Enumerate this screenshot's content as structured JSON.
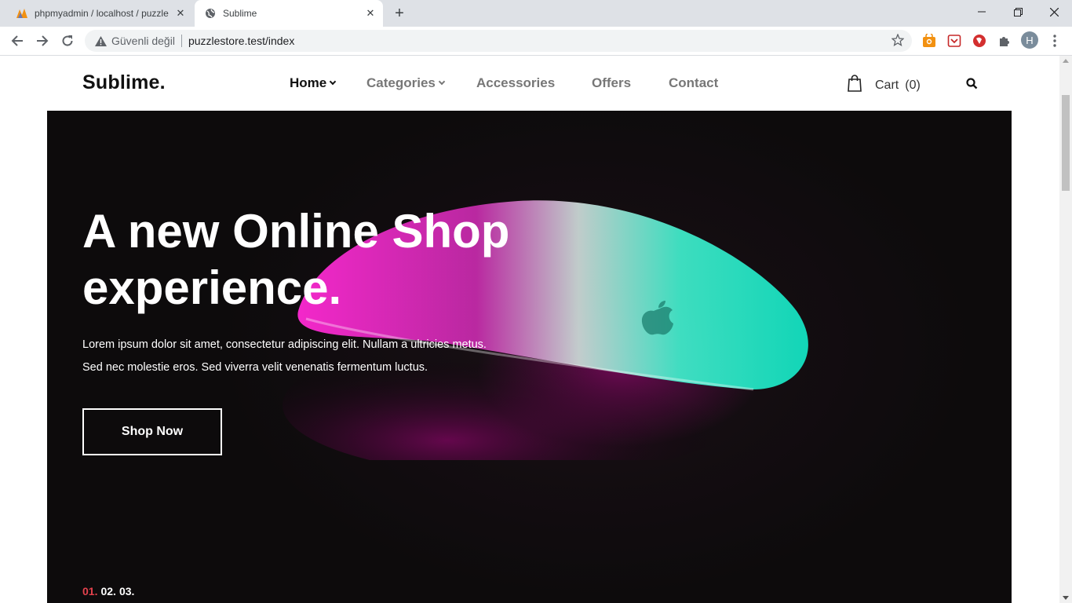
{
  "browser": {
    "tabs": [
      {
        "title": "phpmyadmin / localhost / puzzle",
        "active": false
      },
      {
        "title": "Sublime",
        "active": true
      }
    ],
    "address": {
      "security_label": "Güvenli değil",
      "url": "puzzlestore.test/index"
    },
    "profile_initial": "H"
  },
  "site": {
    "logo": "Sublime.",
    "nav": [
      {
        "label": "Home",
        "active": true,
        "has_dropdown": true
      },
      {
        "label": "Categories",
        "active": false,
        "has_dropdown": true
      },
      {
        "label": "Accessories",
        "active": false,
        "has_dropdown": false
      },
      {
        "label": "Offers",
        "active": false,
        "has_dropdown": false
      },
      {
        "label": "Contact",
        "active": false,
        "has_dropdown": false
      }
    ],
    "cart": {
      "label": "Cart",
      "count": "(0)"
    }
  },
  "hero": {
    "title_line1": "A new Online Shop",
    "title_line2": "experience.",
    "desc_line1": "Lorem ipsum dolor sit amet, consectetur adipiscing elit. Nullam a ultricies metus.",
    "desc_line2": "Sed nec molestie eros. Sed viverra velit venenatis fermentum luctus.",
    "cta": "Shop Now",
    "slides": [
      "01.",
      "02.",
      "03."
    ]
  },
  "colors": {
    "accent": "#e4424d",
    "hero_bg": "#0d0b0c",
    "mouse_pink": "#ff2ad4",
    "mouse_teal": "#1de9c8"
  }
}
